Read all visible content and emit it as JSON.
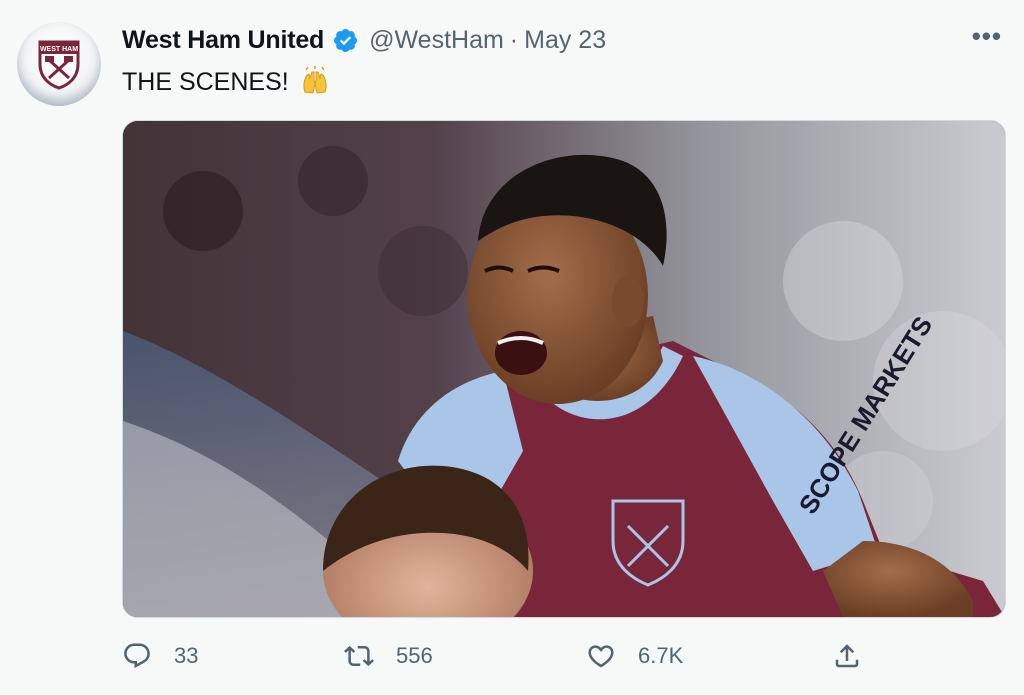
{
  "author": {
    "display_name": "West Ham United",
    "handle": "@WestHam",
    "separator": "·",
    "date": "May 23",
    "verified": true,
    "avatar_icon": "west-ham-crest-icon"
  },
  "tweet": {
    "text": "THE SCENES!",
    "emoji": "raising-hands-emoji"
  },
  "more_icon": "more-horizontal-icon",
  "more_label": "•••",
  "media": {
    "description_icon": "photo",
    "shirt_sponsor": "SCOPE MARKETS"
  },
  "actions": {
    "reply": {
      "count": "33",
      "icon": "reply-icon"
    },
    "retweet": {
      "count": "556",
      "icon": "retweet-icon"
    },
    "like": {
      "count": "6.7K",
      "icon": "heart-icon"
    },
    "share": {
      "icon": "share-icon"
    }
  },
  "colors": {
    "background": "#f7f9f9",
    "text": "#0f1419",
    "secondary": "#536471",
    "verified": "#1d9bf0",
    "claret": "#7a263a",
    "sky_blue": "#a9c5e8"
  }
}
